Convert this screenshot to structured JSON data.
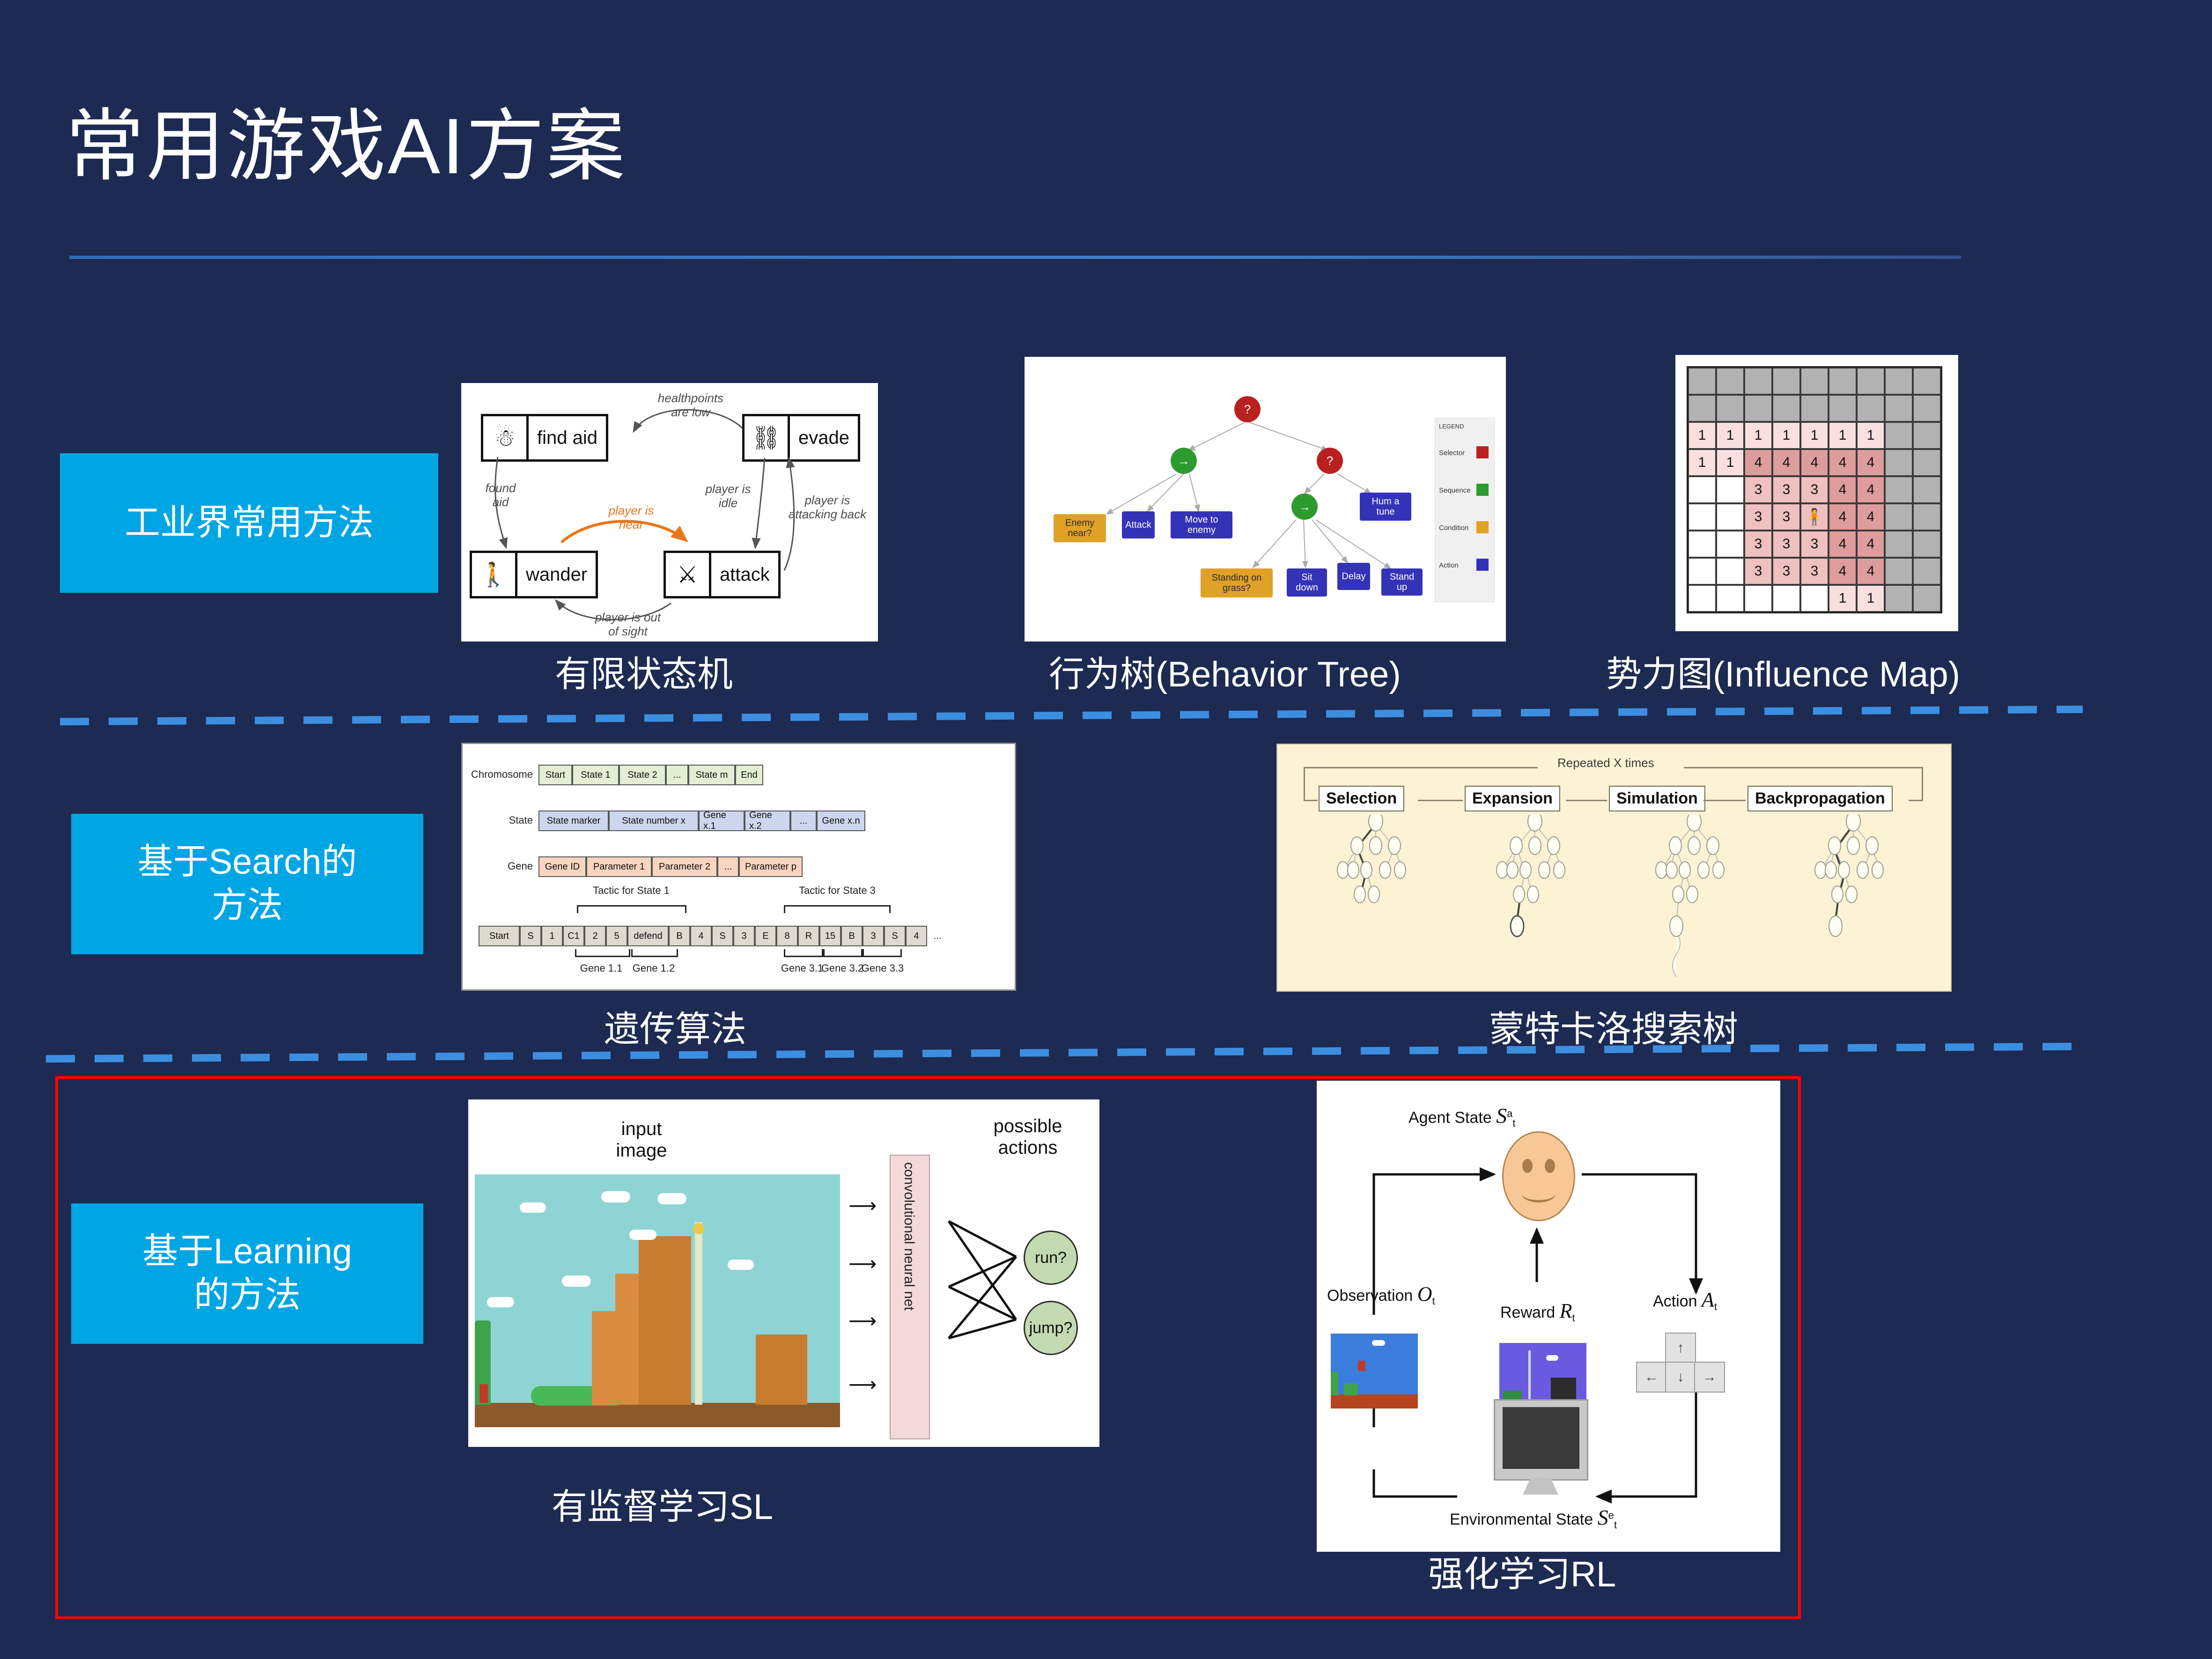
{
  "slide": {
    "title": "常用游戏AI方案",
    "background_color": "#1d2a52",
    "accent_color": "#00a5e4",
    "highlight_border_color": "#ff0000",
    "divider_color": "#3c8ee0"
  },
  "sections": [
    {
      "label": "工业界常用方法"
    },
    {
      "label": "基于Search的\n方法",
      "line1": "基于Search的",
      "line2": "方法"
    },
    {
      "label": "基于Learning\n的方法",
      "line1": "基于Learning",
      "line2": "的方法"
    }
  ],
  "captions": {
    "fsm": "有限状态机",
    "behavior_tree": "行为树(Behavior Tree)",
    "influence_map": "势力图(Influence Map)",
    "genetic_algorithm": "遗传算法",
    "mcts": "蒙特卡洛搜索树",
    "supervised_learning": "有监督学习SL",
    "reinforcement_learning": "强化学习RL"
  },
  "fsm_diagram": {
    "states": [
      {
        "label": "find aid",
        "icon": "health-potion-icon"
      },
      {
        "label": "evade",
        "icon": "running-person-icon"
      },
      {
        "label": "wander",
        "icon": "walking-person-icon"
      },
      {
        "label": "attack",
        "icon": "fighting-person-icon"
      }
    ],
    "transitions": [
      {
        "label": "healthpoints\nare low",
        "line1": "healthpoints",
        "line2": "are low",
        "highlight": false
      },
      {
        "label": "found\naid",
        "line1": "found",
        "line2": "aid",
        "highlight": false
      },
      {
        "label": "player is\nidle",
        "line1": "player is",
        "line2": "idle",
        "highlight": false
      },
      {
        "label": "player is\nattacking back",
        "line1": "player is",
        "line2": "attacking back",
        "highlight": false
      },
      {
        "label": "player is\nnear",
        "line1": "player is",
        "line2": "near",
        "highlight": true
      },
      {
        "label": "player is out\nof sight",
        "line1": "player is out",
        "line2": "of sight",
        "highlight": false
      }
    ]
  },
  "behavior_tree": {
    "legend_title": "LEGEND",
    "legend": [
      {
        "label": "Selector",
        "color": "#b92020"
      },
      {
        "label": "Sequence",
        "color": "#2e9b2e"
      },
      {
        "label": "Condition",
        "color": "#e0a127"
      },
      {
        "label": "Action",
        "color": "#3333b8"
      }
    ],
    "nodes": {
      "root": "?",
      "seq_left": "→",
      "sel_right": "?",
      "seq_right": "→"
    },
    "leaves": [
      {
        "label": "Enemy near?",
        "type": "condition"
      },
      {
        "label": "Attack",
        "type": "action"
      },
      {
        "label": "Move to enemy",
        "type": "action"
      },
      {
        "label": "Standing on grass?",
        "type": "condition"
      },
      {
        "label": "Sit down",
        "type": "action"
      },
      {
        "label": "Delay",
        "type": "action"
      },
      {
        "label": "Stand up",
        "type": "action"
      },
      {
        "label": "Hum a tune",
        "type": "action"
      }
    ]
  },
  "influence_map": {
    "rows": 9,
    "cols": 9,
    "agent_cell": {
      "row": 5,
      "col": 4,
      "icon": "person-icon"
    },
    "grid": [
      [
        "g",
        "g",
        "g",
        "g",
        "g",
        "g",
        "g",
        "g",
        "g"
      ],
      [
        "g",
        "g",
        "g",
        "g",
        "g",
        "g",
        "g",
        "g",
        "g"
      ],
      [
        "1",
        "1",
        "1",
        "1",
        "1",
        "1",
        "1",
        "g",
        "g"
      ],
      [
        "1",
        "1",
        "4",
        "4",
        "4",
        "4",
        "4",
        "g",
        "g"
      ],
      [
        "",
        "",
        "3",
        "3",
        "3",
        "4",
        "4",
        "g",
        "g"
      ],
      [
        "",
        "",
        "3",
        "3",
        "A",
        "4",
        "4",
        "g",
        "g"
      ],
      [
        "",
        "",
        "3",
        "3",
        "3",
        "4",
        "4",
        "g",
        "g"
      ],
      [
        "",
        "",
        "3",
        "3",
        "3",
        "4",
        "4",
        "g",
        "g"
      ],
      [
        "",
        "",
        "",
        "",
        "",
        "1",
        "1",
        "g",
        "g"
      ]
    ]
  },
  "genetic_algorithm": {
    "row_labels": {
      "chromosome": "Chromosome",
      "state": "State",
      "gene": "Gene"
    },
    "chromosome_cells": [
      "Start",
      "State 1",
      "State 2",
      "...",
      "State m",
      "End"
    ],
    "state_cells": [
      "State marker",
      "State number x",
      "Gene x.1",
      "Gene x.2",
      "...",
      "Gene x.n"
    ],
    "gene_cells": [
      "Gene ID",
      "Parameter 1",
      "Parameter 2",
      "...",
      "Parameter p"
    ],
    "tactic_labels": [
      "Tactic for State 1",
      "Tactic for State 3"
    ],
    "gene_labels": [
      "Gene 1.1",
      "Gene 1.2",
      "Gene 3.1",
      "Gene 3.2",
      "Gene 3.3"
    ],
    "encoded_sequence": [
      "Start",
      "S",
      "1",
      "C1",
      "2",
      "5",
      "defend",
      "B",
      "4",
      "S",
      "3",
      "E",
      "8",
      "R",
      "15",
      "B",
      "3",
      "S",
      "4",
      "..."
    ]
  },
  "mcts": {
    "repeat_label": "Repeated X times",
    "phases": [
      "Selection",
      "Expansion",
      "Simulation",
      "Backpropagation"
    ]
  },
  "supervised_learning": {
    "input_label_line1": "input",
    "input_label_line2": "image",
    "network_label": "convolutional neural net",
    "output_label_line1": "possible",
    "output_label_line2": "actions",
    "actions": [
      "run?",
      "jump?"
    ]
  },
  "reinforcement_learning": {
    "agent_state_label": "Agent State",
    "agent_state_symbol": "S",
    "agent_state_sup": "a",
    "agent_state_sub": "t",
    "observation_label": "Observation",
    "observation_symbol": "O",
    "observation_sub": "t",
    "reward_label": "Reward",
    "reward_symbol": "R",
    "reward_sub": "t",
    "action_label": "Action",
    "action_symbol": "A",
    "action_sub": "t",
    "env_state_label": "Environmental State",
    "env_state_symbol": "S",
    "env_state_sup": "e",
    "env_state_sub": "t",
    "action_keys": [
      "↑",
      "←",
      "↓",
      "→"
    ]
  }
}
